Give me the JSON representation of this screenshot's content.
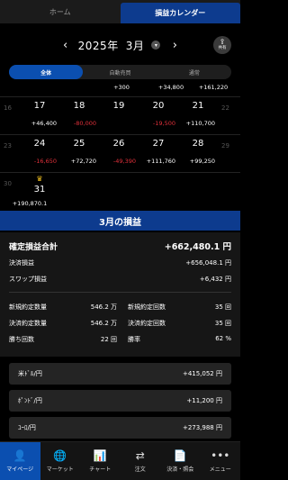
{
  "tabs": [
    {
      "label": "ホーム",
      "active": false
    },
    {
      "label": "損益カレンダー",
      "active": true
    }
  ],
  "month_nav": {
    "year": "2025年",
    "month": "3月",
    "share_label": "共有"
  },
  "filters": [
    {
      "label": "全体",
      "active": true
    },
    {
      "label": "自動売買",
      "active": false
    },
    {
      "label": "通常",
      "active": false
    }
  ],
  "calendar": {
    "top_amounts": [
      "+300",
      "+34,800",
      "+161,220"
    ],
    "weeks": [
      {
        "days": [
          {
            "day": "16",
            "dim": true,
            "amount": ""
          },
          {
            "day": "17",
            "dim": false,
            "amount": "+46,400",
            "sign": "pos"
          },
          {
            "day": "18",
            "dim": false,
            "amount": "-80,000",
            "sign": "neg"
          },
          {
            "day": "19",
            "dim": false,
            "amount": "",
            "sign": "pos"
          },
          {
            "day": "20",
            "dim": false,
            "amount": "-19,500",
            "sign": "neg"
          },
          {
            "day": "21",
            "dim": false,
            "amount": "+110,700",
            "sign": "pos"
          },
          {
            "day": "22",
            "dim": true,
            "amount": ""
          }
        ]
      },
      {
        "days": [
          {
            "day": "23",
            "dim": true,
            "amount": ""
          },
          {
            "day": "24",
            "dim": false,
            "amount": "-16,650",
            "sign": "neg"
          },
          {
            "day": "25",
            "dim": false,
            "amount": "+72,720",
            "sign": "pos"
          },
          {
            "day": "26",
            "dim": false,
            "amount": "-49,390",
            "sign": "neg"
          },
          {
            "day": "27",
            "dim": false,
            "amount": "+111,760",
            "sign": "pos"
          },
          {
            "day": "28",
            "dim": false,
            "amount": "+99,250",
            "sign": "pos"
          },
          {
            "day": "29",
            "dim": true,
            "amount": ""
          }
        ]
      },
      {
        "days": [
          {
            "day": "30",
            "dim": true,
            "amount": ""
          },
          {
            "day": "31",
            "dim": false,
            "amount": "+190,870.1",
            "sign": "pos",
            "crown": true
          }
        ]
      }
    ]
  },
  "month_header": "3月の損益",
  "summary": {
    "total_label": "確定損益合計",
    "total_value": "+662,480.1 円",
    "settle_label": "決済損益",
    "settle_value": "+656,048.1 円",
    "swap_label": "スワップ損益",
    "swap_value": "+6,432 円",
    "stats": [
      {
        "l1": "新規約定数量",
        "v1": "546.2 万",
        "l2": "新規約定回数",
        "v2": "35 回"
      },
      {
        "l1": "決済約定数量",
        "v1": "546.2 万",
        "l2": "決済約定回数",
        "v2": "35 回"
      },
      {
        "l1": "勝ち回数",
        "v1": "22 回",
        "l2": "勝率",
        "v2": "62 %"
      }
    ]
  },
  "pairs": [
    {
      "name": "米ﾄﾞﾙ/円",
      "value": "+415,052 円"
    },
    {
      "name": "ﾎﾟﾝﾄﾞ/円",
      "value": "+11,200 円"
    },
    {
      "name": "ﾕｰﾛ/円",
      "value": "+273,988 円"
    }
  ],
  "bottom_nav": [
    {
      "label": "マイページ",
      "icon": "person-icon",
      "glyph": "👤",
      "active": true
    },
    {
      "label": "マーケット",
      "icon": "globe-icon",
      "glyph": "🌐",
      "active": false
    },
    {
      "label": "チャート",
      "icon": "chart-icon",
      "glyph": "📊",
      "active": false
    },
    {
      "label": "注文",
      "icon": "order-icon",
      "glyph": "⇄",
      "active": false
    },
    {
      "label": "決済・照会",
      "icon": "document-icon",
      "glyph": "📄",
      "active": false
    },
    {
      "label": "メニュー",
      "icon": "menu-dots-icon",
      "glyph": "•••",
      "active": false
    }
  ],
  "colors": {
    "accent": "#0d3b8e",
    "active_blue": "#0b4fb0",
    "negative": "#e0303a",
    "crown": "#f0c020"
  }
}
